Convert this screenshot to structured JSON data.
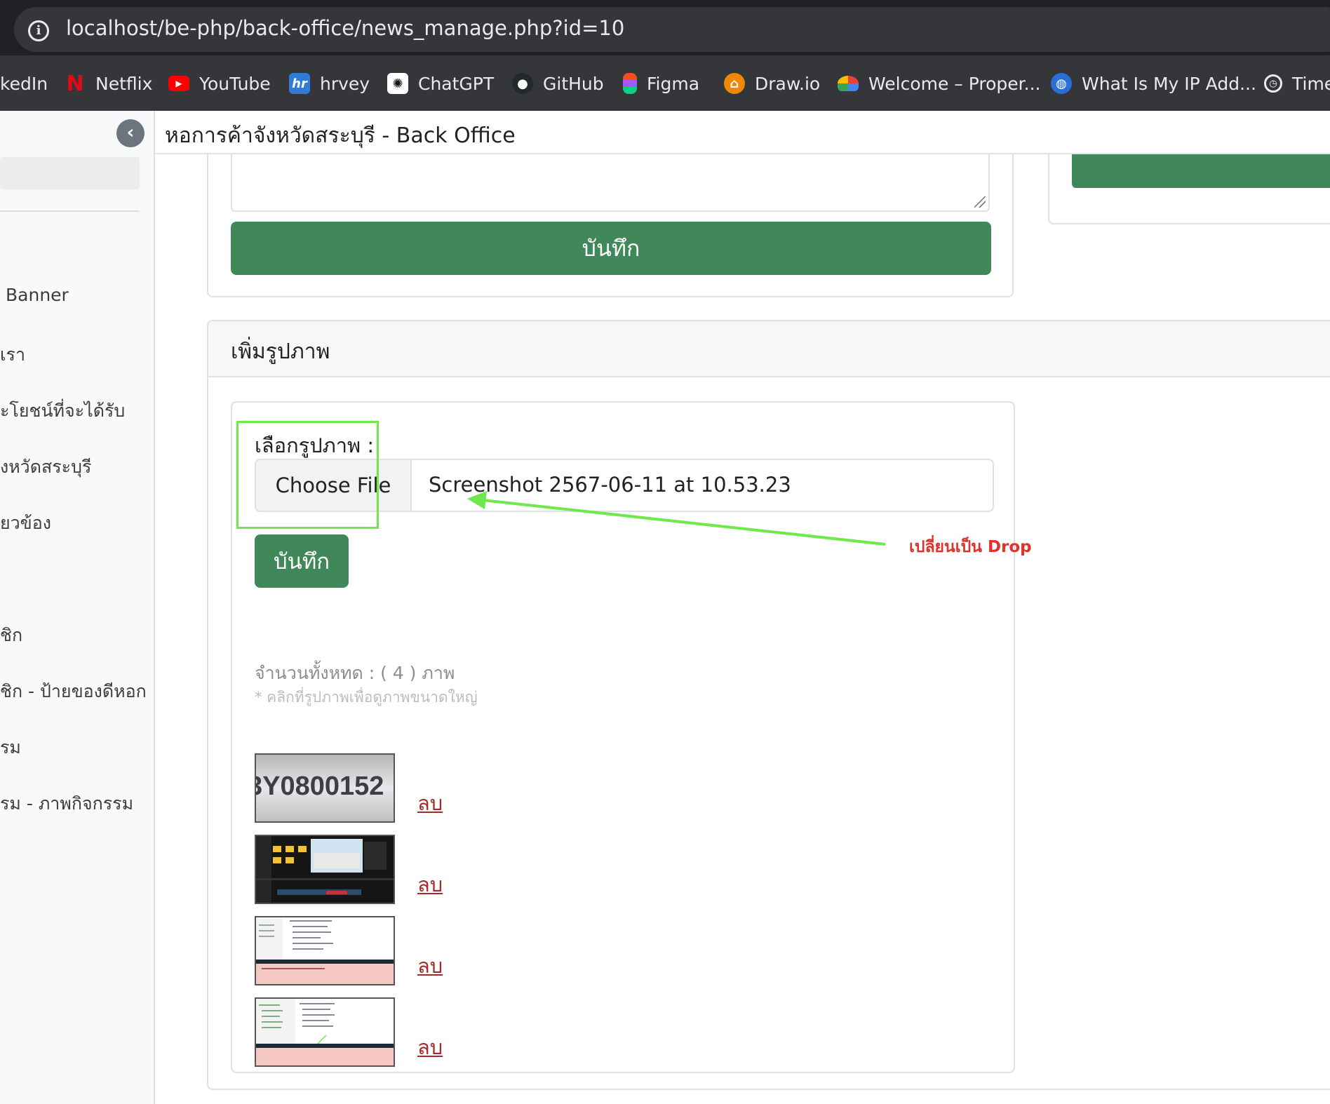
{
  "browser": {
    "url": "localhost/be-php/back-office/news_manage.php?id=10",
    "bookmarks": [
      {
        "label": "kedIn",
        "icon": "linkedin-icon"
      },
      {
        "label": "Netflix",
        "icon": "netflix-icon"
      },
      {
        "label": "YouTube",
        "icon": "youtube-icon"
      },
      {
        "label": "hrvey",
        "icon": "hrvey-icon"
      },
      {
        "label": "ChatGPT",
        "icon": "chatgpt-icon"
      },
      {
        "label": "GitHub",
        "icon": "github-icon"
      },
      {
        "label": "Figma",
        "icon": "figma-icon"
      },
      {
        "label": "Draw.io",
        "icon": "drawio-icon"
      },
      {
        "label": "Welcome – Proper...",
        "icon": "google-cloud-icon"
      },
      {
        "label": "What Is My IP Add...",
        "icon": "globe-icon"
      },
      {
        "label": "Time",
        "icon": "clock-icon"
      }
    ]
  },
  "header": {
    "title": "หอการค้าจังหวัดสระบุรี - Back Office"
  },
  "sidebar": {
    "items": [
      {
        "label": "Banner"
      },
      {
        "label": "เรา"
      },
      {
        "label": "ะโยชน์ที่จะได้รับ"
      },
      {
        "label": "งหวัดสระบุรี"
      },
      {
        "label": "ยวข้อง"
      },
      {
        "label": "ชิก"
      },
      {
        "label": "ชิก - ป้ายของดีหอก"
      },
      {
        "label": "รม"
      },
      {
        "label": "รม - ภาพกิจกรรม"
      }
    ]
  },
  "form_top": {
    "save_label": "บันทึก"
  },
  "images_card": {
    "title": "เพิ่มรูปภาพ",
    "file_label": "เลือกรูปภาพ :",
    "choose_file_label": "Choose File",
    "file_name": "Screenshot 2567-06-11 at 10.53.23",
    "save_label": "บันทึก",
    "count_text": "จำนวนทั้งหทด : ( 4 ) ภาพ",
    "hint_text": "* คลิกที่รูปภาพเพื่อดูภาพขนาดใหญ่",
    "images": [
      {
        "thumb_text": "3Y0800152",
        "delete_label": "ลบ"
      },
      {
        "delete_label": "ลบ"
      },
      {
        "delete_label": "ลบ"
      },
      {
        "delete_label": "ลบ"
      }
    ]
  },
  "annotation": {
    "note": "เปลี่ยนเป็น Drop",
    "color": "#6ee84a",
    "text_color": "#e0322d"
  },
  "colors": {
    "primary_green": "#40875a",
    "delete_link": "#a52a2a"
  }
}
